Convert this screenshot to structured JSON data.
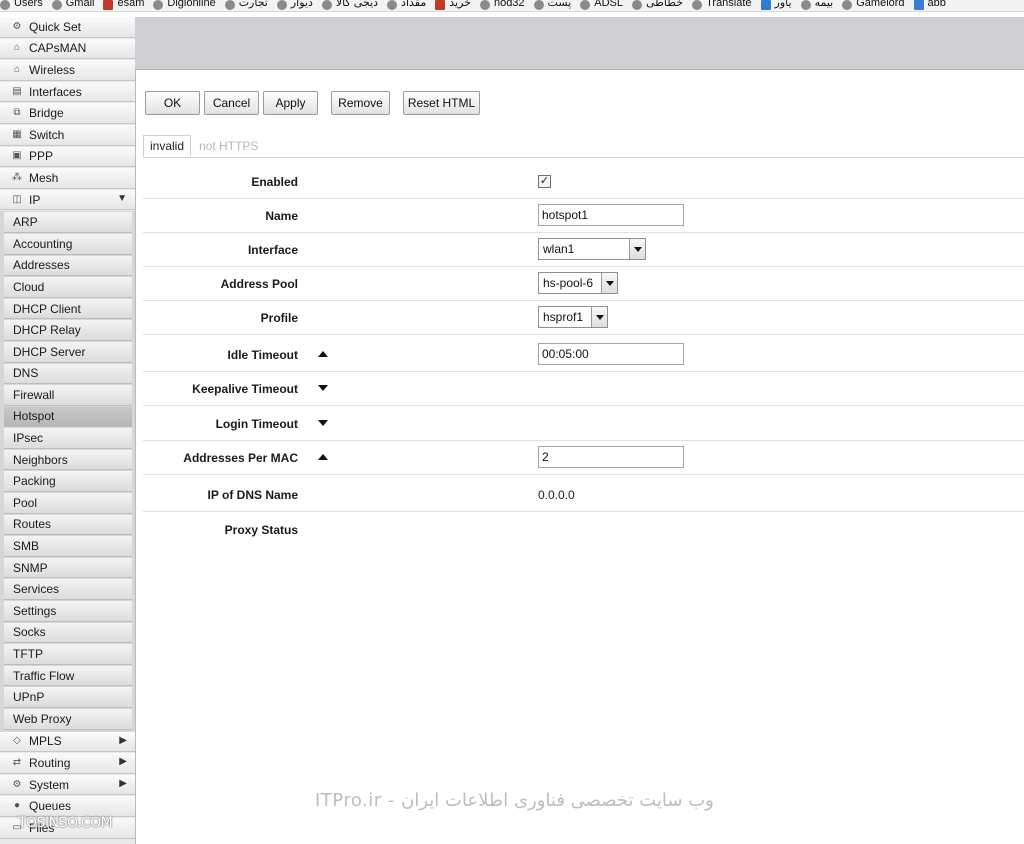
{
  "bookmarks": [
    "Users",
    "Gmail",
    "esam",
    "Digionline",
    "تجارت",
    "دیوار",
    "دیجی کالا",
    "مقداد",
    "خرید",
    "nod32",
    "پست",
    "ADSL",
    "خطاطی",
    "Translate",
    "یاور",
    "بیمه",
    "Gamelord",
    "abb"
  ],
  "sidebar": {
    "items_top": [
      {
        "label": "Quick Set",
        "icon": "quick-set-icon"
      },
      {
        "label": "CAPsMAN",
        "icon": "capsman-icon"
      },
      {
        "label": "Wireless",
        "icon": "wireless-icon"
      },
      {
        "label": "Interfaces",
        "icon": "interfaces-icon"
      },
      {
        "label": "Bridge",
        "icon": "bridge-icon"
      },
      {
        "label": "Switch",
        "icon": "switch-icon"
      },
      {
        "label": "PPP",
        "icon": "ppp-icon"
      },
      {
        "label": "Mesh",
        "icon": "mesh-icon"
      },
      {
        "label": "IP",
        "icon": "ip-icon",
        "expanded": true
      }
    ],
    "ip_submenu": [
      "ARP",
      "Accounting",
      "Addresses",
      "Cloud",
      "DHCP Client",
      "DHCP Relay",
      "DHCP Server",
      "DNS",
      "Firewall",
      "Hotspot",
      "IPsec",
      "Neighbors",
      "Packing",
      "Pool",
      "Routes",
      "SMB",
      "SNMP",
      "Services",
      "Settings",
      "Socks",
      "TFTP",
      "Traffic Flow",
      "UPnP",
      "Web Proxy"
    ],
    "active_submenu": "Hotspot",
    "items_bottom": [
      {
        "label": "MPLS",
        "icon": "mpls-icon",
        "has_arrow": true
      },
      {
        "label": "Routing",
        "icon": "routing-icon",
        "has_arrow": true
      },
      {
        "label": "System",
        "icon": "system-icon",
        "has_arrow": true
      },
      {
        "label": "Queues",
        "icon": "queues-icon"
      },
      {
        "label": "Files",
        "icon": "files-icon"
      }
    ]
  },
  "toolbar": {
    "ok": "OK",
    "cancel": "Cancel",
    "apply": "Apply",
    "remove": "Remove",
    "reset_html": "Reset HTML"
  },
  "tabs": {
    "active": "invalid",
    "inactive": "not HTTPS"
  },
  "form": {
    "enabled": {
      "label": "Enabled",
      "checked": true
    },
    "name": {
      "label": "Name",
      "value": "hotspot1"
    },
    "interface": {
      "label": "Interface",
      "value": "wlan1"
    },
    "address_pool": {
      "label": "Address Pool",
      "value": "hs-pool-6"
    },
    "profile": {
      "label": "Profile",
      "value": "hsprof1"
    },
    "idle_timeout": {
      "label": "Idle Timeout",
      "value": "00:05:00",
      "toggle": "up"
    },
    "keepalive_timeout": {
      "label": "Keepalive Timeout",
      "toggle": "down"
    },
    "login_timeout": {
      "label": "Login Timeout",
      "toggle": "down"
    },
    "addresses_per_mac": {
      "label": "Addresses Per MAC",
      "value": "2",
      "toggle": "up"
    },
    "ip_of_dns_name": {
      "label": "IP of DNS Name",
      "value": "0.0.0.0"
    },
    "proxy_status": {
      "label": "Proxy Status",
      "value": ""
    }
  },
  "watermarks": {
    "itpro": "ITPro.ir - وب سایت تخصصی فناوری اطلاعات ایران",
    "tosinso": "TOSINSO.COM"
  },
  "colors": {
    "topbar": "#cfcfd4",
    "sidebar": "#e9e9e9",
    "active_item": "#bdbdbd"
  }
}
